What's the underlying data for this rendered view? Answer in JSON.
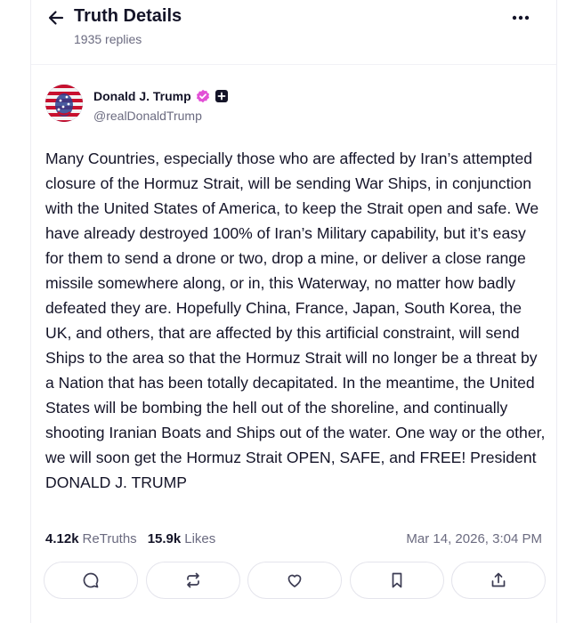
{
  "header": {
    "title": "Truth Details",
    "reply_count": "1935 replies",
    "back_icon": "arrow-left-icon",
    "more_icon": "more-horizontal-icon"
  },
  "post": {
    "author": {
      "name": "Donald J. Trump",
      "handle": "@realDonaldTrump",
      "verified_color": "#e24fd6"
    },
    "text": "Many Countries, especially those who are affected by Iran’s attempted closure of the Hormuz Strait, will be sending War Ships, in conjunction with the United States of America, to keep the Strait open and safe. We have already destroyed 100% of Iran’s Military capability, but it’s easy for them to send a drone or two, drop a mine, or deliver a close range missile somewhere along, or in, this Waterway, no matter how badly defeated they are. Hopefully China, France, Japan, South Korea, the UK, and others, that are affected by this artificial constraint, will send Ships to the area so that the Hormuz Strait will no longer be a threat by a Nation that has been totally decapitated. In the meantime, the United States will be bombing the hell out of the shoreline, and continually shooting Iranian Boats and Ships out of the water. One way or the other, we will soon get the Hormuz Strait OPEN, SAFE, and FREE! President DONALD J. TRUMP",
    "stats": {
      "retruths_count": "4.12k",
      "retruths_label": "ReTruths",
      "likes_count": "15.9k",
      "likes_label": "Likes"
    },
    "timestamp": "Mar 14, 2026, 3:04 PM"
  },
  "actions": [
    "reply-icon",
    "retruth-icon",
    "like-icon",
    "bookmark-icon",
    "share-icon"
  ]
}
